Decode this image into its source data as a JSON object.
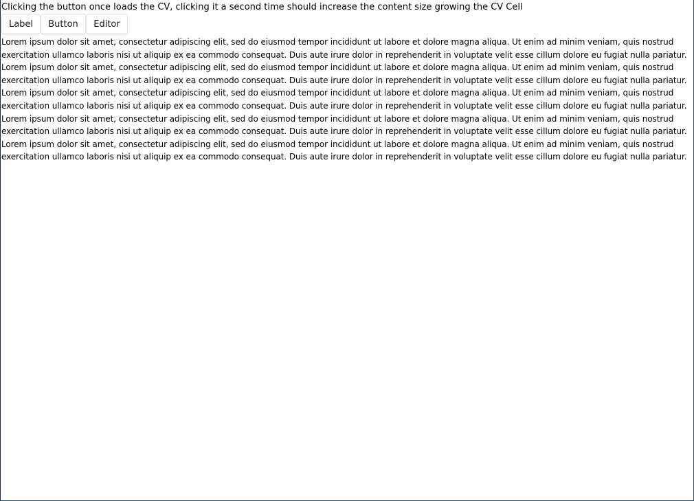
{
  "instructions": "Clicking the button once loads the CV, clicking it a second time should increase the content size growing the CV Cell",
  "buttons": {
    "label": "Label",
    "button": "Button",
    "editor": "Editor"
  },
  "paragraphs": [
    "Lorem ipsum dolor sit amet, consectetur adipiscing elit, sed do eiusmod tempor incididunt ut labore et dolore magna aliqua. Ut enim ad minim veniam, quis nostrud exercitation ullamco laboris nisi ut aliquip ex ea commodo consequat. Duis aute irure dolor in reprehenderit in voluptate velit esse cillum dolore eu fugiat nulla pariatur.",
    "Lorem ipsum dolor sit amet, consectetur adipiscing elit, sed do eiusmod tempor incididunt ut labore et dolore magna aliqua. Ut enim ad minim veniam, quis nostrud exercitation ullamco laboris nisi ut aliquip ex ea commodo consequat. Duis aute irure dolor in reprehenderit in voluptate velit esse cillum dolore eu fugiat nulla pariatur.",
    "Lorem ipsum dolor sit amet, consectetur adipiscing elit, sed do eiusmod tempor incididunt ut labore et dolore magna aliqua. Ut enim ad minim veniam, quis nostrud exercitation ullamco laboris nisi ut aliquip ex ea commodo consequat. Duis aute irure dolor in reprehenderit in voluptate velit esse cillum dolore eu fugiat nulla pariatur.",
    "Lorem ipsum dolor sit amet, consectetur adipiscing elit, sed do eiusmod tempor incididunt ut labore et dolore magna aliqua. Ut enim ad minim veniam, quis nostrud exercitation ullamco laboris nisi ut aliquip ex ea commodo consequat. Duis aute irure dolor in reprehenderit in voluptate velit esse cillum dolore eu fugiat nulla pariatur.",
    "Lorem ipsum dolor sit amet, consectetur adipiscing elit, sed do eiusmod tempor incididunt ut labore et dolore magna aliqua. Ut enim ad minim veniam, quis nostrud exercitation ullamco laboris nisi ut aliquip ex ea commodo consequat. Duis aute irure dolor in reprehenderit in voluptate velit esse cillum dolore eu fugiat nulla pariatur."
  ]
}
